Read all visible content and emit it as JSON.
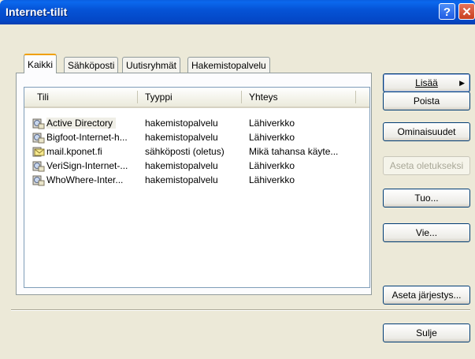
{
  "window": {
    "title": "Internet-tilit"
  },
  "tabs": [
    {
      "label": "Kaikki"
    },
    {
      "label": "Sähköposti"
    },
    {
      "label": "Uutisryhmät"
    },
    {
      "label": "Hakemistopalvelu"
    }
  ],
  "list": {
    "columns": [
      "Tili",
      "Tyyppi",
      "Yhteys"
    ],
    "rows": [
      {
        "tili": "Active Directory",
        "tyyppi": "hakemistopalvelu",
        "yhteys": "Lähiverkko",
        "icon": "directory-service-icon"
      },
      {
        "tili": "Bigfoot-Internet-h...",
        "tyyppi": "hakemistopalvelu",
        "yhteys": "Lähiverkko",
        "icon": "directory-service-icon"
      },
      {
        "tili": "mail.kponet.fi",
        "tyyppi": "sähköposti (oletus)",
        "yhteys": "Mikä tahansa käyte...",
        "icon": "mail-account-icon"
      },
      {
        "tili": "VeriSign-Internet-...",
        "tyyppi": "hakemistopalvelu",
        "yhteys": "Lähiverkko",
        "icon": "directory-service-icon"
      },
      {
        "tili": "WhoWhere-Inter...",
        "tyyppi": "hakemistopalvelu",
        "yhteys": "Lähiverkko",
        "icon": "directory-service-icon"
      }
    ]
  },
  "buttons": {
    "add": "Lisää",
    "remove": "Poista",
    "properties": "Ominaisuudet",
    "set_default": "Aseta oletukseksi",
    "import": "Tuo...",
    "export": "Vie...",
    "set_order": "Aseta järjestys...",
    "close": "Sulje"
  }
}
